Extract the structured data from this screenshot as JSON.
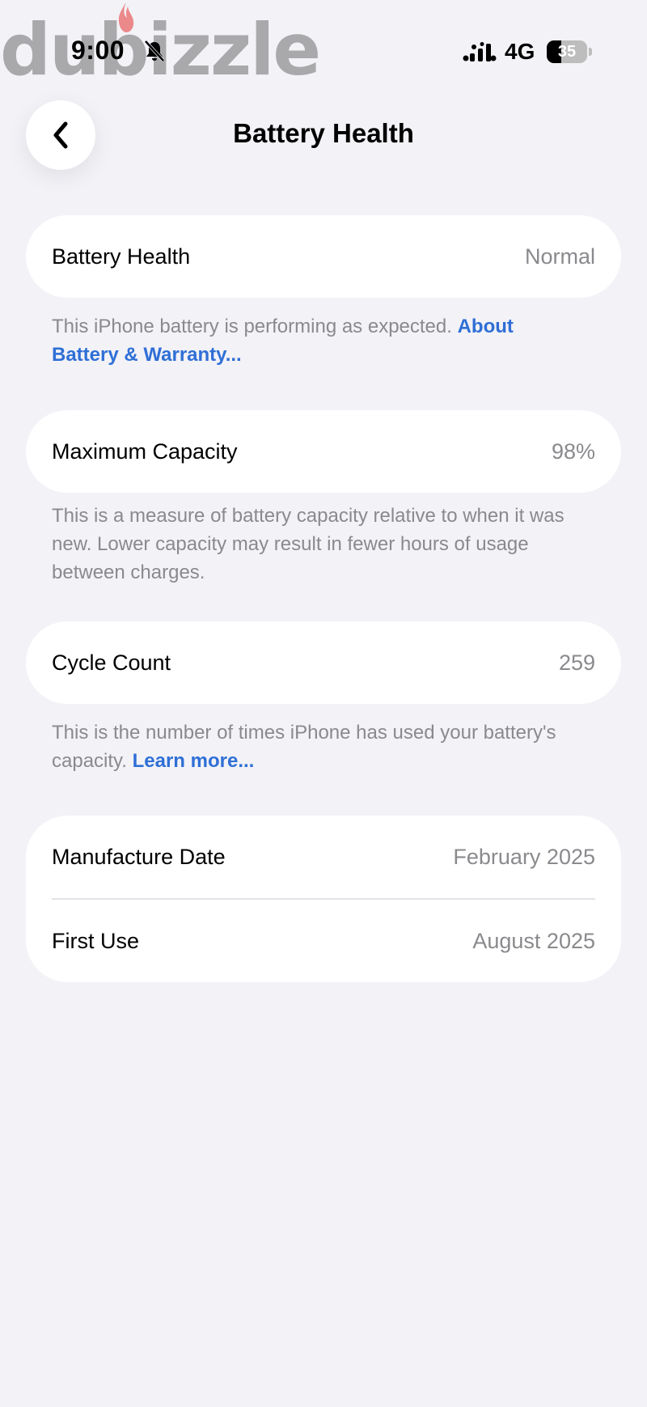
{
  "watermark": {
    "text": "dubizzle"
  },
  "status_bar": {
    "time": "9:00",
    "network": "4G",
    "battery_level": "35",
    "battery_fraction": 0.35
  },
  "nav": {
    "title": "Battery Health"
  },
  "battery_health": {
    "label": "Battery Health",
    "value": "Normal",
    "description": "This iPhone battery is performing as expected.",
    "link": "About Battery & Warranty..."
  },
  "maximum_capacity": {
    "label": "Maximum Capacity",
    "value": "98%",
    "description": "This is a measure of battery capacity relative to when it was new. Lower capacity may result in fewer hours of usage between charges."
  },
  "cycle_count": {
    "label": "Cycle Count",
    "value": "259",
    "description": "This is the number of times iPhone has used your battery's capacity.",
    "link": "Learn more..."
  },
  "dates": {
    "manufacture_label": "Manufacture Date",
    "manufacture_value": "February 2025",
    "first_use_label": "First Use",
    "first_use_value": "August 2025"
  },
  "colors": {
    "background": "#f2f2f7",
    "card": "#ffffff",
    "secondary_text": "#8a8a8e",
    "link": "#2f6fd6"
  }
}
